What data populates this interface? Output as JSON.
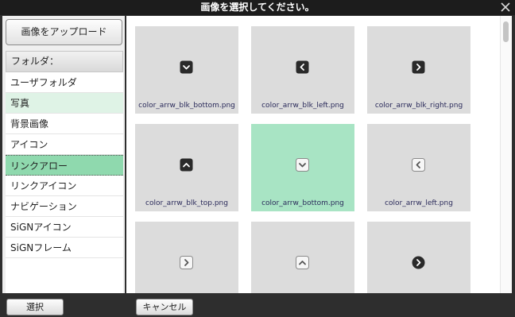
{
  "dialog": {
    "title": "画像を選択してください。",
    "close_icon": "close-icon"
  },
  "sidebar": {
    "upload_label": "画像をアップロード",
    "folder_header": "フォルダ：",
    "folders": [
      {
        "label": "ユーザフォルダ",
        "state": "normal"
      },
      {
        "label": "写真",
        "state": "light"
      },
      {
        "label": "背景画像",
        "state": "normal"
      },
      {
        "label": "アイコン",
        "state": "normal"
      },
      {
        "label": "リンクアロー",
        "state": "selected"
      },
      {
        "label": "リンクアイコン",
        "state": "normal"
      },
      {
        "label": "ナビゲーション",
        "state": "normal"
      },
      {
        "label": "SiGNアイコン",
        "state": "normal"
      },
      {
        "label": "SiGNフレーム",
        "state": "normal"
      }
    ]
  },
  "images": [
    {
      "name": "color_arrw_blk_bottom.png",
      "icon": "chevron-down-dark-icon",
      "selected": false
    },
    {
      "name": "color_arrw_blk_left.png",
      "icon": "chevron-left-dark-icon",
      "selected": false
    },
    {
      "name": "color_arrw_blk_right.png",
      "icon": "chevron-right-dark-icon",
      "selected": false
    },
    {
      "name": "color_arrw_blk_top.png",
      "icon": "chevron-up-dark-icon",
      "selected": false
    },
    {
      "name": "color_arrw_bottom.png",
      "icon": "chevron-down-light-icon",
      "selected": true
    },
    {
      "name": "color_arrw_left.png",
      "icon": "chevron-left-light-icon",
      "selected": false
    },
    {
      "name": "",
      "icon": "chevron-right-light-icon",
      "selected": false
    },
    {
      "name": "",
      "icon": "chevron-up-light-icon",
      "selected": false
    },
    {
      "name": "",
      "icon": "chevron-right-circle-dark-icon",
      "selected": false
    }
  ],
  "footer": {
    "select_label": "選択",
    "cancel_label": "キャンセル"
  },
  "colors": {
    "selected_folder": "#8fd9ae",
    "selected_tile": "#a8e4c4",
    "light_folder": "#dff3e6"
  }
}
